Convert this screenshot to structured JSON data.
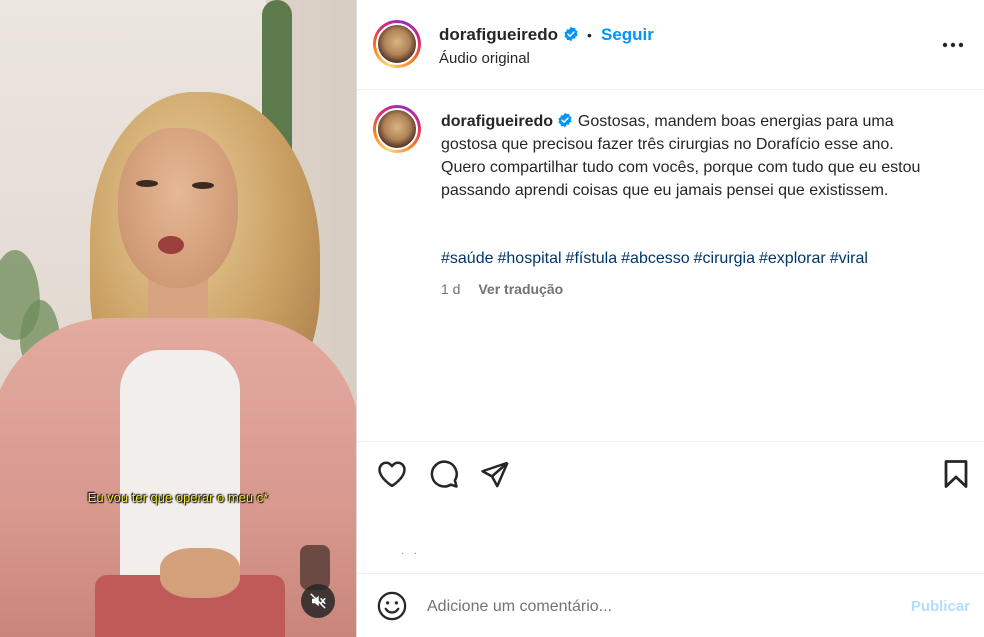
{
  "video": {
    "subtitle": "Eu vou ter que operar o meu c*",
    "mute_icon": "speaker-muted-icon"
  },
  "header": {
    "username": "dorafigueiredo",
    "separator": "•",
    "follow_label": "Seguir",
    "audio_label": "Áudio original",
    "more_icon": "more-horizontal-icon"
  },
  "caption": {
    "username": "dorafigueiredo",
    "text": "Gostosas, mandem boas energias para uma gostosa que precisou fazer três cirurgias no Dorafício esse ano. Quero compartilhar tudo com vocês, porque com tudo que eu estou passando aprendi coisas que eu jamais pensei que existissem.",
    "hashtags": [
      "#saúde",
      "#hospital",
      "#fístula",
      "#abcesso",
      "#cirurgia",
      "#explorar",
      "#viral"
    ],
    "time_ago": "1 d",
    "translate_label": "Ver tradução"
  },
  "actions": {
    "like_icon": "heart-icon",
    "comment_icon": "comment-icon",
    "share_icon": "share-icon",
    "save_icon": "bookmark-icon"
  },
  "likes_placeholder": ". .",
  "comment": {
    "emoji_icon": "emoji-icon",
    "placeholder": "Adicione um comentário...",
    "publish_label": "Publicar"
  },
  "colors": {
    "accent": "#0095f6",
    "verified": "#0095f6",
    "hashtag": "#00376b",
    "publish_disabled": "#b2dffc"
  }
}
